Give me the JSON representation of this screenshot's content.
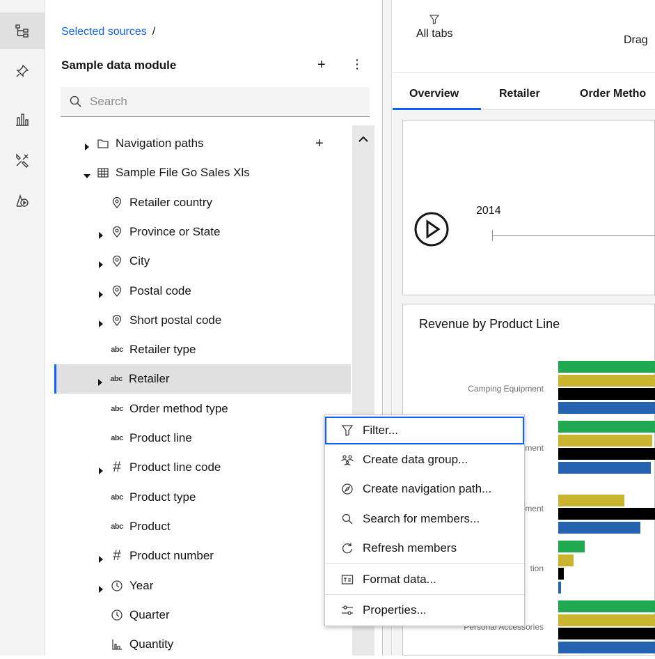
{
  "rail": {
    "items": [
      {
        "icon": "data-tree-icon",
        "active": true
      },
      {
        "icon": "pin-icon",
        "active": false
      },
      {
        "icon": "chart-icon",
        "active": false
      },
      {
        "icon": "tools-icon",
        "active": false
      },
      {
        "icon": "story-icon",
        "active": false
      }
    ]
  },
  "panel": {
    "breadcrumb_link": "Selected sources",
    "breadcrumb_sep": "/",
    "module_title": "Sample data module",
    "add_label": "+",
    "more_label": "⋮",
    "search_placeholder": "Search",
    "tree": [
      {
        "label": "Navigation paths",
        "icon": "folder-icon",
        "expander": "collapsed",
        "level": 0,
        "add": "+"
      },
      {
        "label": "Sample File Go Sales Xls",
        "icon": "table-icon",
        "expander": "expanded",
        "level": 0
      },
      {
        "label": "Retailer country",
        "icon": "location-icon",
        "expander": "none",
        "level": 1
      },
      {
        "label": "Province or State",
        "icon": "location-icon",
        "expander": "collapsed",
        "level": 1
      },
      {
        "label": "City",
        "icon": "location-icon",
        "expander": "collapsed",
        "level": 1
      },
      {
        "label": "Postal code",
        "icon": "location-icon",
        "expander": "collapsed",
        "level": 1
      },
      {
        "label": "Short postal code",
        "icon": "location-icon",
        "expander": "collapsed",
        "level": 1
      },
      {
        "label": "Retailer type",
        "icon": "text-type-icon",
        "expander": "none",
        "level": 1
      },
      {
        "label": "Retailer",
        "icon": "text-type-icon",
        "expander": "collapsed",
        "level": 1,
        "selected": true
      },
      {
        "label": "Order method type",
        "icon": "text-type-icon",
        "expander": "none",
        "level": 1
      },
      {
        "label": "Product line",
        "icon": "text-type-icon",
        "expander": "none",
        "level": 1
      },
      {
        "label": "Product line code",
        "icon": "number-type-icon",
        "expander": "collapsed",
        "level": 1
      },
      {
        "label": "Product type",
        "icon": "text-type-icon",
        "expander": "none",
        "level": 1
      },
      {
        "label": "Product",
        "icon": "text-type-icon",
        "expander": "none",
        "level": 1
      },
      {
        "label": "Product number",
        "icon": "number-type-icon",
        "expander": "collapsed",
        "level": 1
      },
      {
        "label": "Year",
        "icon": "clock-icon",
        "expander": "collapsed",
        "level": 1
      },
      {
        "label": "Quarter",
        "icon": "clock-icon",
        "expander": "none",
        "level": 1
      },
      {
        "label": "Quantity",
        "icon": "measure-icon",
        "expander": "none",
        "level": 1
      }
    ],
    "type_glyphs": {
      "text": "abc",
      "number": "#"
    }
  },
  "content": {
    "filter_label": "All tabs",
    "drag_text": "Drag",
    "tabs": [
      "Overview",
      "Retailer",
      "Order Metho"
    ],
    "active_tab": "Overview",
    "timeline_year": "2014",
    "chart_title": "Revenue by Product Line"
  },
  "chart_data": {
    "type": "bar",
    "title": "Revenue by Product Line",
    "categories": [
      "Camping Equipment",
      "ment",
      "ment",
      "tion",
      "Personal Accessories"
    ],
    "colors": [
      "#1fa84f",
      "#c8b42e",
      "#000000",
      "#2563b0"
    ],
    "series_values": [
      [
        1.0,
        1.0,
        0.0,
        0.27,
        1.0
      ],
      [
        1.0,
        0.97,
        0.68,
        0.16,
        1.0
      ],
      [
        1.0,
        1.0,
        1.0,
        0.06,
        1.0
      ],
      [
        1.0,
        0.96,
        0.85,
        0.03,
        1.0
      ]
    ]
  },
  "menu": {
    "items": [
      {
        "label": "Filter...",
        "icon": "filter-icon",
        "focused": true
      },
      {
        "label": "Create data group...",
        "icon": "data-group-icon"
      },
      {
        "label": "Create navigation path...",
        "icon": "navigation-path-icon"
      },
      {
        "label": "Search for members...",
        "icon": "search-icon"
      },
      {
        "label": "Refresh members",
        "icon": "refresh-icon"
      },
      {
        "label": "Format data...",
        "icon": "format-data-icon"
      },
      {
        "label": "Properties...",
        "icon": "properties-icon"
      }
    ]
  }
}
